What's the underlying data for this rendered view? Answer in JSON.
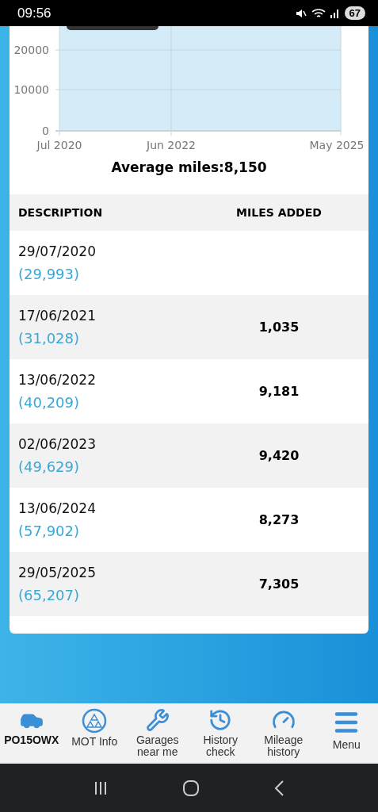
{
  "status_bar": {
    "time": "09:56",
    "battery": "67"
  },
  "chart": {
    "y_ticks": [
      "20000",
      "10000",
      "0"
    ],
    "x_ticks": [
      "Jul 2020",
      "Jun 2022",
      "May 2025"
    ]
  },
  "average": "Average miles:8,150",
  "table": {
    "columns": [
      "DESCRIPTION",
      "MILES ADDED"
    ],
    "rows": [
      {
        "date": "29/07/2020",
        "reading": "(29,993)"
      },
      {
        "date": "17/06/2021",
        "reading": "(31,028)",
        "miles_added": "1,035"
      },
      {
        "date": "13/06/2022",
        "reading": "(40,209)",
        "miles_added": "9,181"
      },
      {
        "date": "02/06/2023",
        "reading": "(49,629)",
        "miles_added": "9,420"
      },
      {
        "date": "13/06/2024",
        "reading": "(57,902)",
        "miles_added": "8,273"
      },
      {
        "date": "29/05/2025",
        "reading": "(65,207)",
        "miles_added": "7,305"
      }
    ]
  },
  "bottom_nav": [
    {
      "kind": "car",
      "label": "PO15OWX"
    },
    {
      "kind": "mot",
      "label": "MOT Info"
    },
    {
      "kind": "garage",
      "label": "Garages near me"
    },
    {
      "kind": "history",
      "label": "History check"
    },
    {
      "kind": "mileage",
      "label": "Mileage history"
    },
    {
      "kind": "menu",
      "label": "Menu"
    }
  ]
}
